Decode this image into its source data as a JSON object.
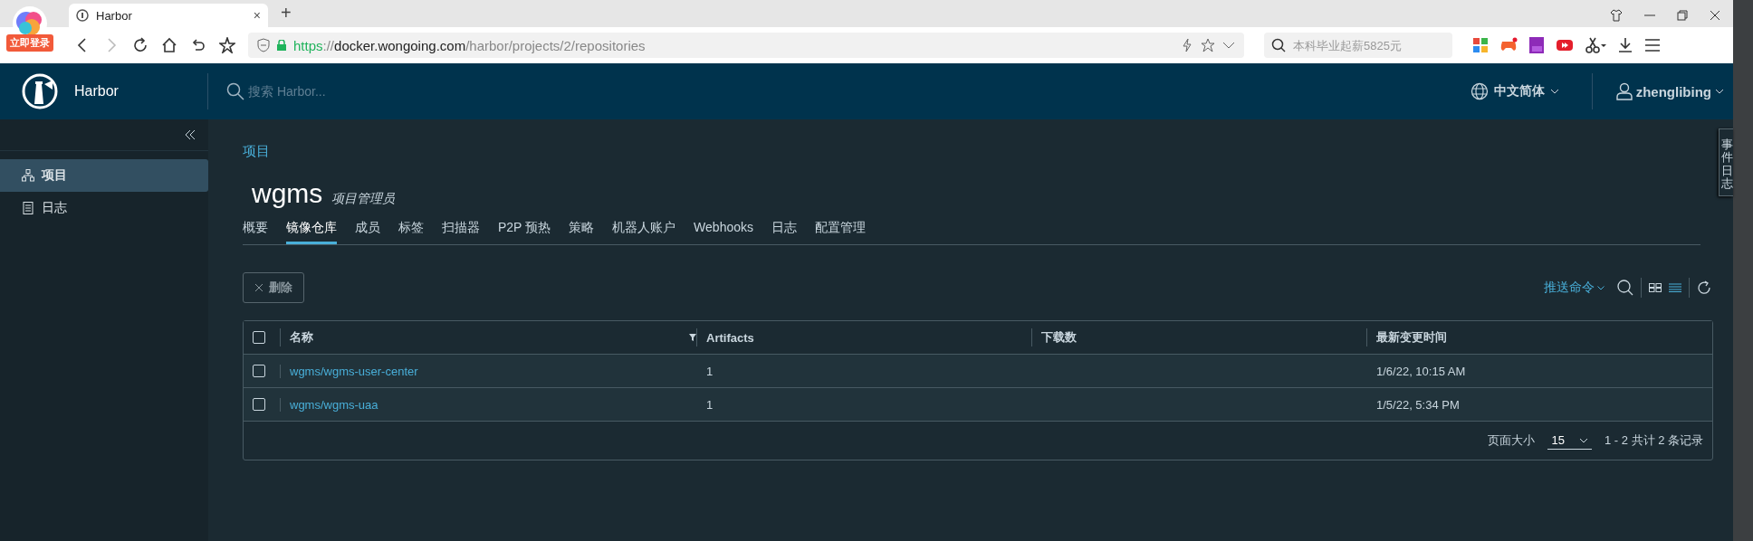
{
  "browser": {
    "badge": "立即登录",
    "tabs": [
      {
        "title": "Harbor",
        "selected": true,
        "close": "×"
      }
    ],
    "new_tab": "+",
    "url": {
      "scheme": "https",
      "separator": "://",
      "host": "docker.wongoing.com",
      "path": "/harbor/projects/2/repositories"
    },
    "search": {
      "placeholder": "本科毕业起薪5825元"
    }
  },
  "header": {
    "brand": "Harbor",
    "search": {
      "placeholder": "搜索 Harbor..."
    },
    "language": "中文简体",
    "user": "zhenglibing"
  },
  "sidebar": {
    "items": [
      {
        "label": "项目",
        "kind": "projects",
        "selected": true
      },
      {
        "label": "日志",
        "kind": "logs",
        "selected": false
      }
    ]
  },
  "breadcrumb": "项目",
  "project": {
    "name": "wgms",
    "role": "项目管理员"
  },
  "tabs": [
    {
      "label": "概要",
      "selected": false
    },
    {
      "label": "镜像仓库",
      "selected": true
    },
    {
      "label": "成员",
      "selected": false
    },
    {
      "label": "标签",
      "selected": false
    },
    {
      "label": "扫描器",
      "selected": false
    },
    {
      "label": "P2P 预热",
      "selected": false
    },
    {
      "label": "策略",
      "selected": false
    },
    {
      "label": "机器人账户",
      "selected": false
    },
    {
      "label": "Webhooks",
      "selected": false
    },
    {
      "label": "日志",
      "selected": false
    },
    {
      "label": "配置管理",
      "selected": false
    }
  ],
  "toolbar": {
    "delete": {
      "label": "删除",
      "disabled": true
    },
    "push_command": "推送命令"
  },
  "table": {
    "select_all": {
      "checked": false
    },
    "columns": [
      {
        "label": "名称",
        "filter": true
      },
      {
        "label": "Artifacts",
        "filter": false
      },
      {
        "label": "下载数",
        "filter": false
      },
      {
        "label": "最新变更时间",
        "filter": false
      }
    ],
    "rows": [
      {
        "checked": false,
        "name": "wgms/wgms-user-center",
        "artifacts": "1",
        "updated": "1/6/22, 10:15 AM"
      },
      {
        "checked": false,
        "name": "wgms/wgms-uaa",
        "artifacts": "1",
        "updated": "1/5/22, 5:34 PM"
      }
    ],
    "footer": {
      "page_size_label": "页面大小",
      "page_size": "15",
      "summary": "1 - 2 共计 2 条记录"
    }
  },
  "side_tab": "事件日志"
}
